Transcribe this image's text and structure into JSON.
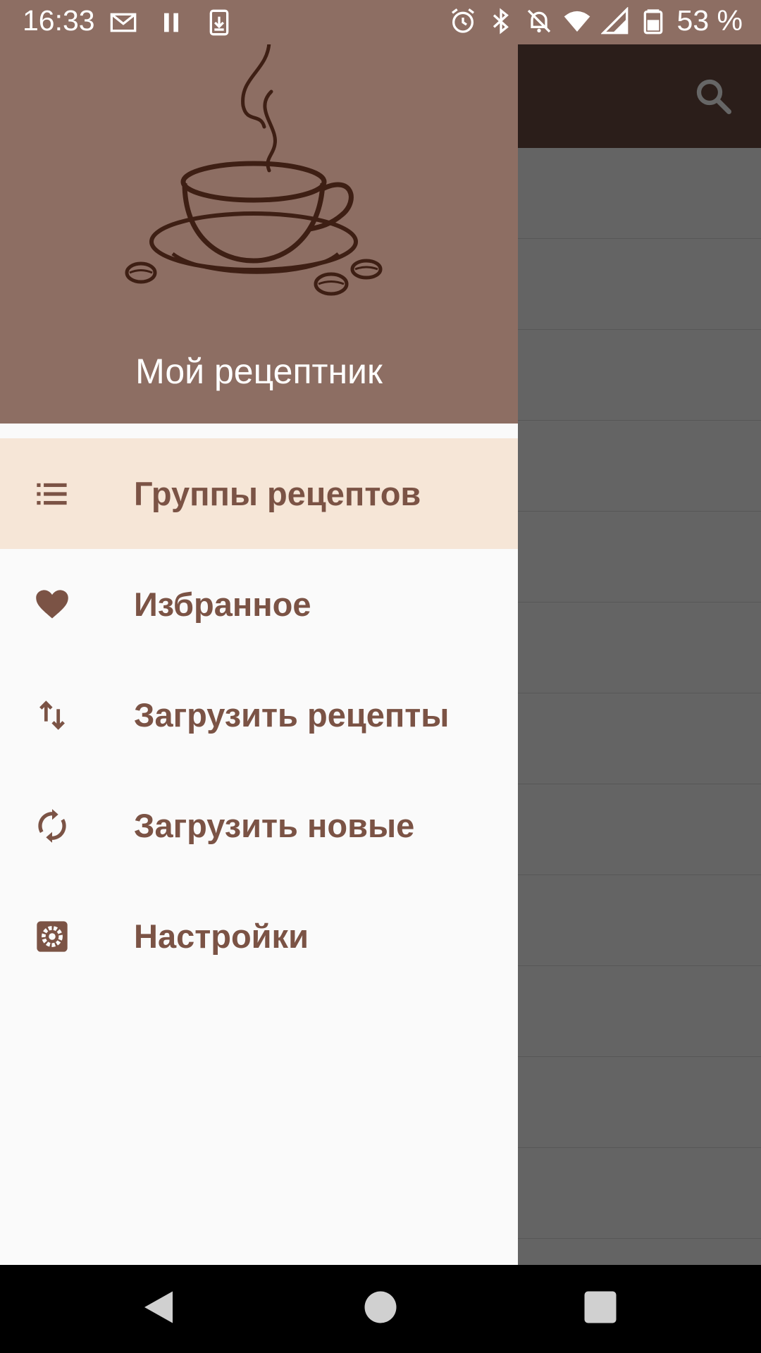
{
  "status_bar": {
    "time": "16:33",
    "battery": "53 %",
    "icons": [
      "gmail-icon",
      "pause-icon",
      "download-icon",
      "alarm-icon",
      "bluetooth-icon",
      "dnd-off-icon",
      "wifi-icon",
      "signal-icon",
      "battery-icon"
    ]
  },
  "drawer": {
    "title": "Мой рецептник",
    "header_icon": "coffee-cup-icon",
    "items": [
      {
        "label": "Группы рецептов",
        "icon": "list-icon",
        "active": true
      },
      {
        "label": "Избранное",
        "icon": "heart-icon",
        "active": false
      },
      {
        "label": "Загрузить рецепты",
        "icon": "swap-vertical-icon",
        "active": false
      },
      {
        "label": "Загрузить новые",
        "icon": "refresh-icon",
        "active": false
      },
      {
        "label": "Настройки",
        "icon": "settings-icon",
        "active": false
      }
    ]
  },
  "colors": {
    "header": "#8d6e63",
    "toolbar": "#6d4c41",
    "active_item_bg": "#f6e6d7",
    "menu_text": "#7b5345",
    "drawer_bg": "#fafafa",
    "nav_bg": "#000000"
  },
  "navigation": {
    "buttons": [
      "back-icon",
      "home-icon",
      "recents-icon"
    ]
  }
}
